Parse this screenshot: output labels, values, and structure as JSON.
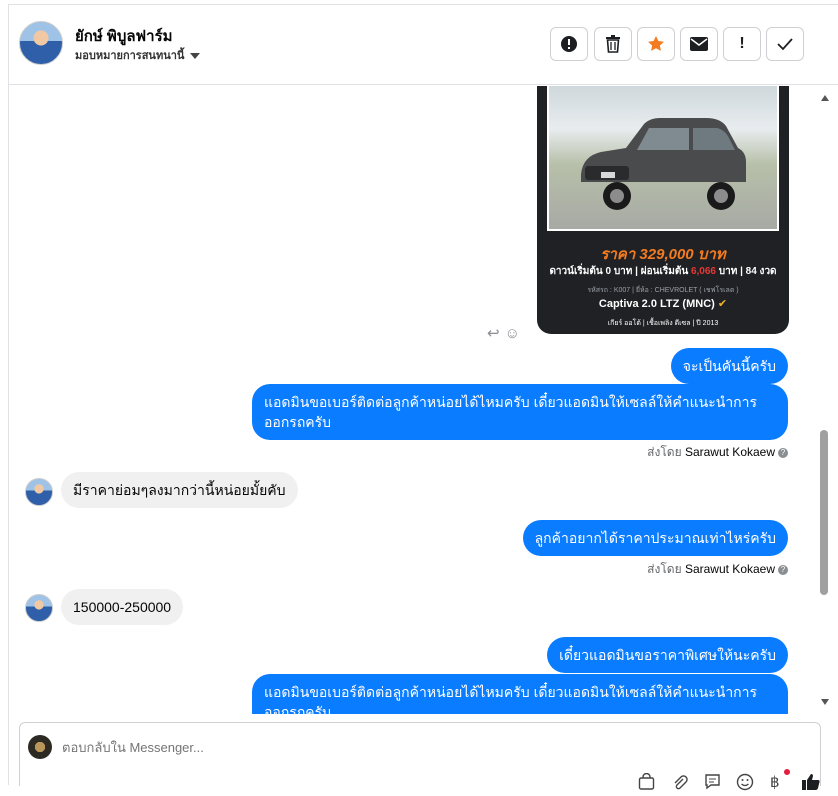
{
  "header": {
    "name": "ยักษ์ พิบูลฟาร์ม",
    "assign_label": "มอบหมายการสนทนานี้",
    "buttons": [
      {
        "icon": "alert-circle-icon",
        "glyph": "!"
      },
      {
        "icon": "trash-icon",
        "glyph": "🗑"
      },
      {
        "icon": "star-icon",
        "glyph": "★"
      },
      {
        "icon": "envelope-icon",
        "glyph": "✉"
      },
      {
        "icon": "exclamation-icon",
        "glyph": "!"
      },
      {
        "icon": "check-icon",
        "glyph": "✓"
      }
    ]
  },
  "card": {
    "price": "ราคา 329,000 บาท",
    "down_prefix": "ดาวน์เริ่มต้น 0 บาท | ผ่อนเริ่มต้น",
    "installment": "6,066",
    "down_suffix": "บาท | 84 งวด",
    "meta": "รหัสรถ : K007 | ยี่ห้อ : CHEVROLET ( เชฟโรเลต )",
    "model": "Captiva 2.0 LTZ (MNC)",
    "specs": "เกียร์ ออโต้ | เชื้อเพลิง ดีเซล | ปี 2013"
  },
  "messages": [
    {
      "dir": "out",
      "text": "จะเป็นคันนี้ครับ"
    },
    {
      "dir": "out",
      "text": "แอดมินขอเบอร์ติดต่อลูกค้าหน่อยได้ไหมครับ เดี๋ยวแอดมินให้เซลล์ให้คำแนะนำการออกรถครับ"
    },
    {
      "dir": "sent_by",
      "prefix": "ส่งโดย",
      "name": "Sarawut Kokaew"
    },
    {
      "dir": "in",
      "text": "มีราคาย่อมๆลงมากว่านี้หน่อยมั้ยคับ"
    },
    {
      "dir": "out",
      "text": "ลูกค้าอยากได้ราคาประมาณเท่าไหร่ครับ"
    },
    {
      "dir": "sent_by",
      "prefix": "ส่งโดย",
      "name": "Sarawut Kokaew"
    },
    {
      "dir": "in",
      "text": "150000-250000"
    },
    {
      "dir": "out",
      "text": "เดี๋ยวแอดมินขอราคาพิเศษให้นะครับ"
    },
    {
      "dir": "out",
      "text": "แอดมินขอเบอร์ติดต่อลูกค้าหน่อยได้ไหมครับ เดี๋ยวแอดมินให้เซลล์ให้คำแนะนำการออกรถครับ"
    }
  ],
  "composer": {
    "placeholder": "ตอบกลับใน Messenger...",
    "icons": [
      "shopping-bag-icon",
      "paperclip-icon",
      "chat-bubble-icon",
      "emoji-icon",
      "baht-icon",
      "thumbs-up-icon"
    ]
  }
}
